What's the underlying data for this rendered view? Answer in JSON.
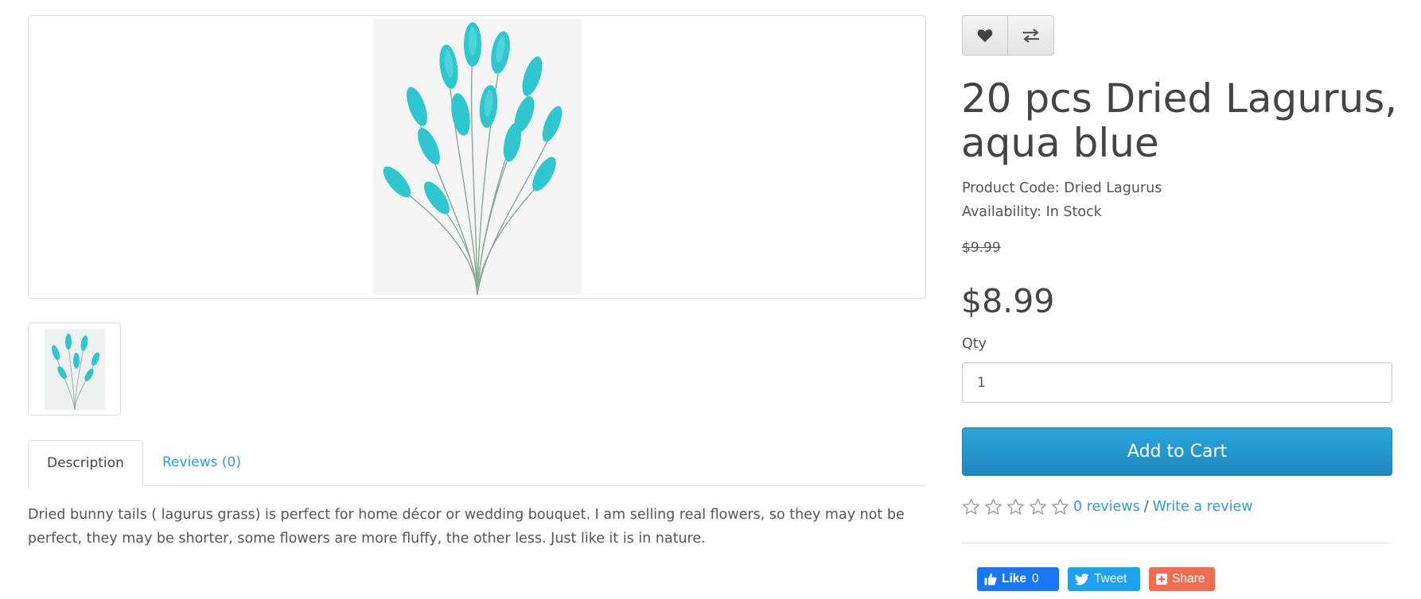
{
  "gallery": {
    "main_image_alt": "20 pcs Dried Lagurus, aqua blue",
    "thumbnail_alt": "20 pcs Dried Lagurus, aqua blue",
    "flower_color": "#2ec7cf"
  },
  "actions": {
    "wishlist_icon": "heart-icon",
    "compare_icon": "exchange-icon"
  },
  "product": {
    "title": "20 pcs Dried Lagurus, aqua blue",
    "product_code": "Product Code: Dried Lagurus",
    "availability": "Availability: In Stock",
    "old_price": "$9.99",
    "price": "$8.99",
    "qty_label": "Qty",
    "qty_value": "1",
    "add_to_cart": "Add to Cart"
  },
  "tabs": [
    {
      "label": "Description",
      "active": true
    },
    {
      "label": "Reviews (0)",
      "active": false
    }
  ],
  "description": "Dried bunny tails ( lagurus grass) is perfect for home décor or wedding bouquet. I am selling real flowers, so they may not be perfect, they may be shorter, some flowers are more fluffy, the other less. Just like it is in nature.",
  "rating": {
    "stars_filled": 0,
    "stars_total": 5,
    "reviews_link": "0 reviews",
    "separator": "/",
    "write_review": "Write a review"
  },
  "share": {
    "like_label": "Like",
    "like_count": "0",
    "tweet_label": "Tweet",
    "share_label": "Share"
  },
  "colors": {
    "accent_link": "#2a9fd6",
    "cart_button": "#229ad2",
    "facebook": "#1877f2",
    "twitter": "#1da1f2",
    "share": "#f26c4f"
  }
}
